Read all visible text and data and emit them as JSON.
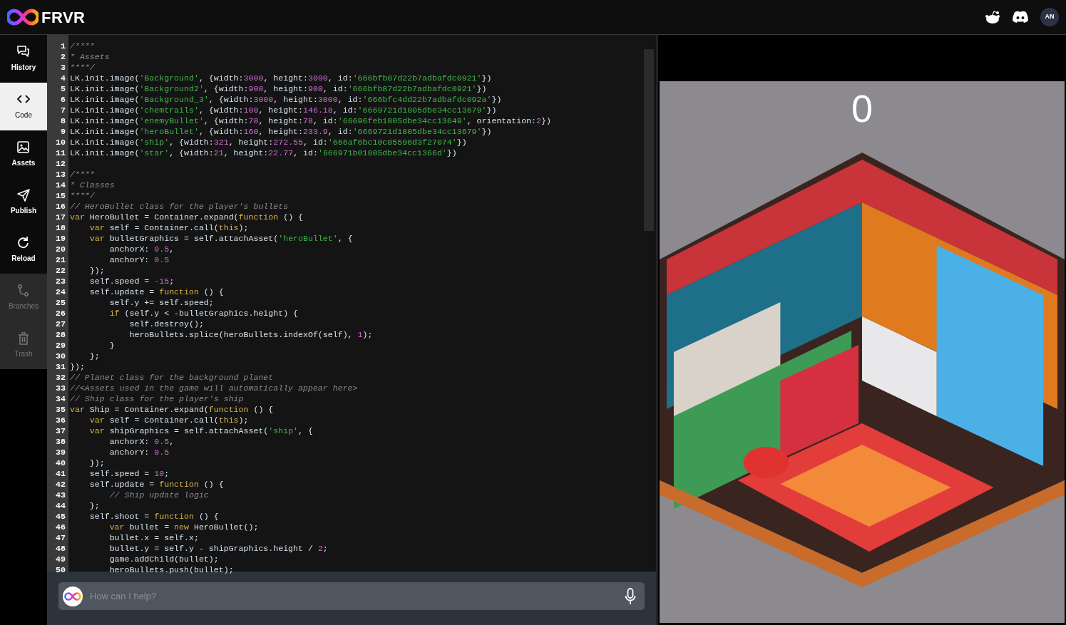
{
  "header": {
    "brand": "FRVR",
    "user_initials": "AN"
  },
  "sidebar": {
    "items": [
      {
        "label": "History",
        "kind": "history",
        "selected": false,
        "disabled": false
      },
      {
        "label": "Code",
        "kind": "code",
        "selected": true,
        "disabled": false
      },
      {
        "label": "Assets",
        "kind": "assets",
        "selected": false,
        "disabled": false
      },
      {
        "label": "Publish",
        "kind": "publish",
        "selected": false,
        "disabled": false
      },
      {
        "label": "Reload",
        "kind": "reload",
        "selected": false,
        "disabled": false
      },
      {
        "label": "Branches",
        "kind": "branches",
        "selected": false,
        "disabled": true
      },
      {
        "label": "Trash",
        "kind": "trash",
        "selected": false,
        "disabled": true
      }
    ]
  },
  "editor": {
    "lines": [
      {
        "number": "1",
        "tokens": [
          {
            "text": "/****",
            "kind": "comment"
          }
        ]
      },
      {
        "number": "2",
        "tokens": [
          {
            "text": "* Assets",
            "kind": "comment"
          }
        ]
      },
      {
        "number": "3",
        "tokens": [
          {
            "text": "****/",
            "kind": "comment"
          }
        ]
      },
      {
        "number": "4",
        "tokens": [
          {
            "text": "LK.init.image(",
            "kind": "plain"
          },
          {
            "text": "'Background'",
            "kind": "string"
          },
          {
            "text": ", {width:",
            "kind": "plain"
          },
          {
            "text": "3000",
            "kind": "number"
          },
          {
            "text": ", height:",
            "kind": "plain"
          },
          {
            "text": "3000",
            "kind": "number"
          },
          {
            "text": ", id:",
            "kind": "plain"
          },
          {
            "text": "'666bfb87d22b7adbafdc0921'",
            "kind": "string"
          },
          {
            "text": "})",
            "kind": "plain"
          }
        ]
      },
      {
        "number": "5",
        "tokens": [
          {
            "text": "LK.init.image(",
            "kind": "plain"
          },
          {
            "text": "'Background2'",
            "kind": "string"
          },
          {
            "text": ", {width:",
            "kind": "plain"
          },
          {
            "text": "900",
            "kind": "number"
          },
          {
            "text": ", height:",
            "kind": "plain"
          },
          {
            "text": "900",
            "kind": "number"
          },
          {
            "text": ", id:",
            "kind": "plain"
          },
          {
            "text": "'666bfb87d22b7adbafdc0921'",
            "kind": "string"
          },
          {
            "text": "})",
            "kind": "plain"
          }
        ]
      },
      {
        "number": "6",
        "tokens": [
          {
            "text": "LK.init.image(",
            "kind": "plain"
          },
          {
            "text": "'Background_3'",
            "kind": "string"
          },
          {
            "text": ", {width:",
            "kind": "plain"
          },
          {
            "text": "3000",
            "kind": "number"
          },
          {
            "text": ", height:",
            "kind": "plain"
          },
          {
            "text": "3000",
            "kind": "number"
          },
          {
            "text": ", id:",
            "kind": "plain"
          },
          {
            "text": "'666bfc4dd22b7adbafdc092a'",
            "kind": "string"
          },
          {
            "text": "})",
            "kind": "plain"
          }
        ]
      },
      {
        "number": "7",
        "tokens": [
          {
            "text": "LK.init.image(",
            "kind": "plain"
          },
          {
            "text": "'chemtrails'",
            "kind": "string"
          },
          {
            "text": ", {width:",
            "kind": "plain"
          },
          {
            "text": "100",
            "kind": "number"
          },
          {
            "text": ", height:",
            "kind": "plain"
          },
          {
            "text": "146.18",
            "kind": "number"
          },
          {
            "text": ", id:",
            "kind": "plain"
          },
          {
            "text": "'6669721d1805dbe34cc13679'",
            "kind": "string"
          },
          {
            "text": "})",
            "kind": "plain"
          }
        ]
      },
      {
        "number": "8",
        "tokens": [
          {
            "text": "LK.init.image(",
            "kind": "plain"
          },
          {
            "text": "'enemyBullet'",
            "kind": "string"
          },
          {
            "text": ", {width:",
            "kind": "plain"
          },
          {
            "text": "78",
            "kind": "number"
          },
          {
            "text": ", height:",
            "kind": "plain"
          },
          {
            "text": "78",
            "kind": "number"
          },
          {
            "text": ", id:",
            "kind": "plain"
          },
          {
            "text": "'66696feb1805dbe34cc13649'",
            "kind": "string"
          },
          {
            "text": ", orientation:",
            "kind": "plain"
          },
          {
            "text": "2",
            "kind": "number"
          },
          {
            "text": "})",
            "kind": "plain"
          }
        ]
      },
      {
        "number": "9",
        "tokens": [
          {
            "text": "LK.init.image(",
            "kind": "plain"
          },
          {
            "text": "'heroBullet'",
            "kind": "string"
          },
          {
            "text": ", {width:",
            "kind": "plain"
          },
          {
            "text": "160",
            "kind": "number"
          },
          {
            "text": ", height:",
            "kind": "plain"
          },
          {
            "text": "233.9",
            "kind": "number"
          },
          {
            "text": ", id:",
            "kind": "plain"
          },
          {
            "text": "'6669721d1805dbe34cc13679'",
            "kind": "string"
          },
          {
            "text": "})",
            "kind": "plain"
          }
        ]
      },
      {
        "number": "10",
        "tokens": [
          {
            "text": "LK.init.image(",
            "kind": "plain"
          },
          {
            "text": "'ship'",
            "kind": "string"
          },
          {
            "text": ", {width:",
            "kind": "plain"
          },
          {
            "text": "321",
            "kind": "number"
          },
          {
            "text": ", height:",
            "kind": "plain"
          },
          {
            "text": "272.55",
            "kind": "number"
          },
          {
            "text": ", id:",
            "kind": "plain"
          },
          {
            "text": "'666af6bc10c85596d3f27074'",
            "kind": "string"
          },
          {
            "text": "})",
            "kind": "plain"
          }
        ]
      },
      {
        "number": "11",
        "tokens": [
          {
            "text": "LK.init.image(",
            "kind": "plain"
          },
          {
            "text": "'star'",
            "kind": "string"
          },
          {
            "text": ", {width:",
            "kind": "plain"
          },
          {
            "text": "21",
            "kind": "number"
          },
          {
            "text": ", height:",
            "kind": "plain"
          },
          {
            "text": "22.77",
            "kind": "number"
          },
          {
            "text": ", id:",
            "kind": "plain"
          },
          {
            "text": "'666971b01805dbe34cc1366d'",
            "kind": "string"
          },
          {
            "text": "})",
            "kind": "plain"
          }
        ]
      },
      {
        "number": "12"
      },
      {
        "number": "13",
        "tokens": [
          {
            "text": "/****",
            "kind": "comment"
          }
        ]
      },
      {
        "number": "14",
        "tokens": [
          {
            "text": "* Classes",
            "kind": "comment"
          }
        ]
      },
      {
        "number": "15",
        "tokens": [
          {
            "text": "****/",
            "kind": "comment"
          }
        ]
      },
      {
        "number": "16",
        "tokens": [
          {
            "text": "// HeroBullet class for the player's bullets",
            "kind": "comment"
          }
        ]
      },
      {
        "number": "17",
        "tokens": [
          {
            "text": "var",
            "kind": "keyword"
          },
          {
            "text": " HeroBullet = Container.expand(",
            "kind": "plain"
          },
          {
            "text": "function",
            "kind": "keyword"
          },
          {
            "text": " () {",
            "kind": "plain"
          }
        ]
      },
      {
        "number": "18",
        "tokens": [
          {
            "text": "    var",
            "kind": "keyword"
          },
          {
            "text": " self = Container.call(",
            "kind": "plain"
          },
          {
            "text": "this",
            "kind": "keyword"
          },
          {
            "text": ");",
            "kind": "plain"
          }
        ]
      },
      {
        "number": "19",
        "tokens": [
          {
            "text": "    var",
            "kind": "keyword"
          },
          {
            "text": " bulletGraphics = self.attachAsset(",
            "kind": "plain"
          },
          {
            "text": "'heroBullet'",
            "kind": "string"
          },
          {
            "text": ", {",
            "kind": "plain"
          }
        ]
      },
      {
        "number": "20",
        "tokens": [
          {
            "text": "        anchorX: ",
            "kind": "plain"
          },
          {
            "text": "0.5",
            "kind": "number"
          },
          {
            "text": ",",
            "kind": "plain"
          }
        ]
      },
      {
        "number": "21",
        "tokens": [
          {
            "text": "        anchorY: ",
            "kind": "plain"
          },
          {
            "text": "0.5",
            "kind": "number"
          }
        ]
      },
      {
        "number": "22",
        "tokens": [
          {
            "text": "    });",
            "kind": "plain"
          }
        ]
      },
      {
        "number": "23",
        "tokens": [
          {
            "text": "    self.speed = ",
            "kind": "plain"
          },
          {
            "text": "-15",
            "kind": "number"
          },
          {
            "text": ";",
            "kind": "plain"
          }
        ]
      },
      {
        "number": "24",
        "tokens": [
          {
            "text": "    self.update = ",
            "kind": "plain"
          },
          {
            "text": "function",
            "kind": "keyword"
          },
          {
            "text": " () {",
            "kind": "plain"
          }
        ]
      },
      {
        "number": "25",
        "tokens": [
          {
            "text": "        self.y += self.speed;",
            "kind": "plain"
          }
        ]
      },
      {
        "number": "26",
        "tokens": [
          {
            "text": "        if",
            "kind": "keyword"
          },
          {
            "text": " (self.y < -bulletGraphics.height) {",
            "kind": "plain"
          }
        ]
      },
      {
        "number": "27",
        "tokens": [
          {
            "text": "            self.destroy();",
            "kind": "plain"
          }
        ]
      },
      {
        "number": "28",
        "tokens": [
          {
            "text": "            heroBullets.splice(heroBullets.indexOf(self), ",
            "kind": "plain"
          },
          {
            "text": "1",
            "kind": "number"
          },
          {
            "text": ");",
            "kind": "plain"
          }
        ]
      },
      {
        "number": "29",
        "tokens": [
          {
            "text": "        }",
            "kind": "plain"
          }
        ]
      },
      {
        "number": "30",
        "tokens": [
          {
            "text": "    };",
            "kind": "plain"
          }
        ]
      },
      {
        "number": "31",
        "tokens": [
          {
            "text": "});",
            "kind": "plain"
          }
        ]
      },
      {
        "number": "32",
        "tokens": [
          {
            "text": "// Planet class for the background planet",
            "kind": "comment"
          }
        ]
      },
      {
        "number": "33",
        "tokens": [
          {
            "text": "//<Assets used in the game will automatically appear here>",
            "kind": "comment"
          }
        ]
      },
      {
        "number": "34",
        "tokens": [
          {
            "text": "// Ship class for the player's ship",
            "kind": "comment"
          }
        ]
      },
      {
        "number": "35",
        "tokens": [
          {
            "text": "var",
            "kind": "keyword"
          },
          {
            "text": " Ship = Container.expand(",
            "kind": "plain"
          },
          {
            "text": "function",
            "kind": "keyword"
          },
          {
            "text": " () {",
            "kind": "plain"
          }
        ]
      },
      {
        "number": "36",
        "tokens": [
          {
            "text": "    var",
            "kind": "keyword"
          },
          {
            "text": " self = Container.call(",
            "kind": "plain"
          },
          {
            "text": "this",
            "kind": "keyword"
          },
          {
            "text": ");",
            "kind": "plain"
          }
        ]
      },
      {
        "number": "37",
        "tokens": [
          {
            "text": "    var",
            "kind": "keyword"
          },
          {
            "text": " shipGraphics = self.attachAsset(",
            "kind": "plain"
          },
          {
            "text": "'ship'",
            "kind": "string"
          },
          {
            "text": ", {",
            "kind": "plain"
          }
        ]
      },
      {
        "number": "38",
        "tokens": [
          {
            "text": "        anchorX: ",
            "kind": "plain"
          },
          {
            "text": "0.5",
            "kind": "number"
          },
          {
            "text": ",",
            "kind": "plain"
          }
        ]
      },
      {
        "number": "39",
        "tokens": [
          {
            "text": "        anchorY: ",
            "kind": "plain"
          },
          {
            "text": "0.5",
            "kind": "number"
          }
        ]
      },
      {
        "number": "40",
        "tokens": [
          {
            "text": "    });",
            "kind": "plain"
          }
        ]
      },
      {
        "number": "41",
        "tokens": [
          {
            "text": "    self.speed = ",
            "kind": "plain"
          },
          {
            "text": "10",
            "kind": "number"
          },
          {
            "text": ";",
            "kind": "plain"
          }
        ]
      },
      {
        "number": "42",
        "tokens": [
          {
            "text": "    self.update = ",
            "kind": "plain"
          },
          {
            "text": "function",
            "kind": "keyword"
          },
          {
            "text": " () {",
            "kind": "plain"
          }
        ]
      },
      {
        "number": "43",
        "tokens": [
          {
            "text": "        // Ship update logic",
            "kind": "comment"
          }
        ]
      },
      {
        "number": "44",
        "tokens": [
          {
            "text": "    };",
            "kind": "plain"
          }
        ]
      },
      {
        "number": "45",
        "tokens": [
          {
            "text": "    self.shoot = ",
            "kind": "plain"
          },
          {
            "text": "function",
            "kind": "keyword"
          },
          {
            "text": " () {",
            "kind": "plain"
          }
        ]
      },
      {
        "number": "46",
        "tokens": [
          {
            "text": "        var",
            "kind": "keyword"
          },
          {
            "text": " bullet = ",
            "kind": "plain"
          },
          {
            "text": "new",
            "kind": "keyword"
          },
          {
            "text": " HeroBullet();",
            "kind": "plain"
          }
        ]
      },
      {
        "number": "47",
        "tokens": [
          {
            "text": "        bullet.x = self.x;",
            "kind": "plain"
          }
        ]
      },
      {
        "number": "48",
        "tokens": [
          {
            "text": "        bullet.y = self.y - shipGraphics.height / ",
            "kind": "plain"
          },
          {
            "text": "2",
            "kind": "number"
          },
          {
            "text": ";",
            "kind": "plain"
          }
        ]
      },
      {
        "number": "49",
        "tokens": [
          {
            "text": "        game.addChild(bullet);",
            "kind": "plain"
          }
        ]
      },
      {
        "number": "50",
        "tokens": [
          {
            "text": "        heroBullets.push(bullet);",
            "kind": "plain"
          }
        ]
      }
    ]
  },
  "chat": {
    "placeholder": "How can I help?"
  },
  "preview": {
    "score": "0"
  }
}
